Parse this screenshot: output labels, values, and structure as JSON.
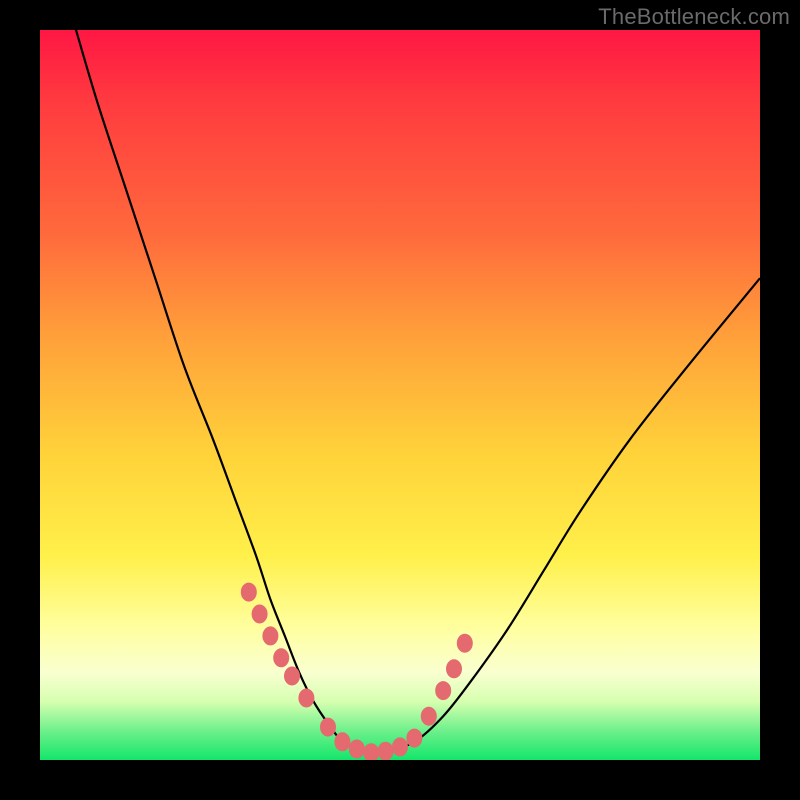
{
  "watermark": "TheBottleneck.com",
  "colors": {
    "gradient_top": "#ff1744",
    "gradient_mid": "#ffd23a",
    "gradient_bottom": "#13e66b",
    "curve": "#000000",
    "marker": "#e46a6f",
    "frame": "#000000"
  },
  "chart_data": {
    "type": "line",
    "title": "",
    "xlabel": "",
    "ylabel": "",
    "xlim": [
      0,
      100
    ],
    "ylim": [
      0,
      100
    ],
    "grid": false,
    "legend": false,
    "series": [
      {
        "name": "bottleneck-curve",
        "x": [
          5,
          8,
          12,
          16,
          20,
          24,
          27,
          30,
          32,
          34,
          36,
          38,
          40,
          42,
          44,
          46,
          48,
          52,
          56,
          60,
          65,
          70,
          75,
          82,
          90,
          100
        ],
        "y": [
          100,
          90,
          78,
          66,
          54,
          44,
          36,
          28,
          22,
          17,
          12,
          8,
          5,
          2.5,
          1.5,
          1,
          1.2,
          2.5,
          6,
          11,
          18,
          26,
          34,
          44,
          54,
          66
        ]
      }
    ],
    "markers": {
      "name": "highlight-points",
      "x": [
        29,
        30.5,
        32,
        33.5,
        35,
        37,
        40,
        42,
        44,
        46,
        48,
        50,
        52,
        54,
        56,
        57.5,
        59
      ],
      "y": [
        23,
        20,
        17,
        14,
        11.5,
        8.5,
        4.5,
        2.5,
        1.5,
        1,
        1.2,
        1.8,
        3,
        6,
        9.5,
        12.5,
        16
      ]
    }
  }
}
